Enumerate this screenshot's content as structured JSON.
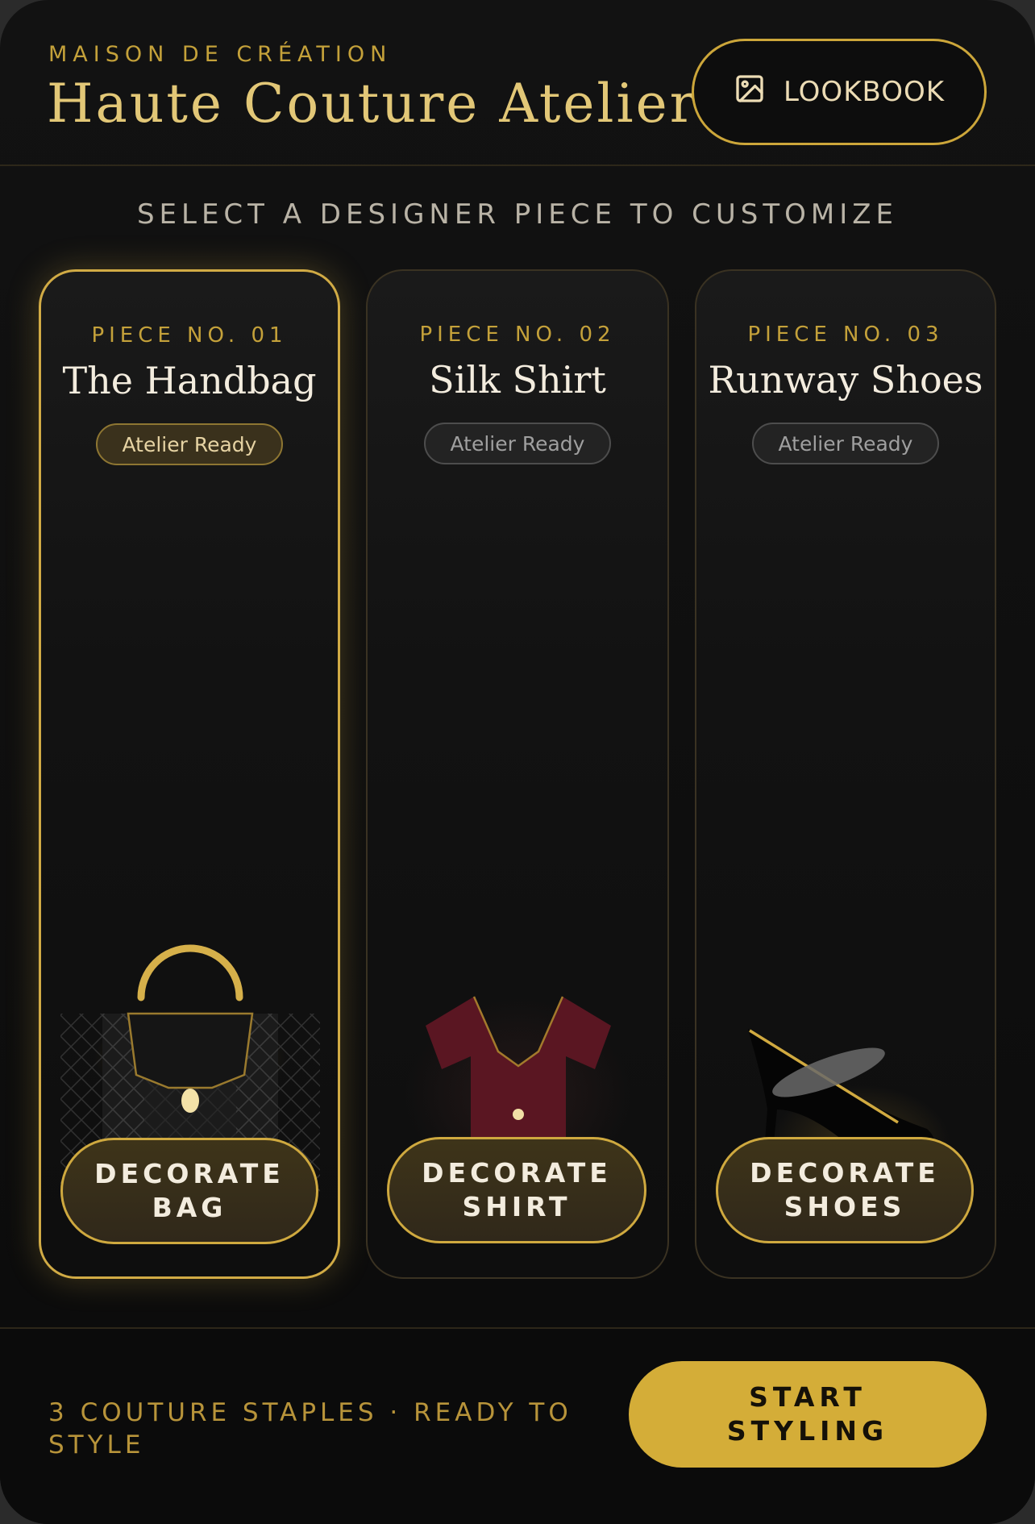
{
  "header": {
    "eyebrow": "MAISON DE CRÉATION",
    "title": "Haute Couture Atelier",
    "lookbook_label": "LOOKBOOK",
    "lookbook_icon": "image-icon"
  },
  "subtitle": "SELECT A DESIGNER PIECE TO CUSTOMIZE",
  "cards": [
    {
      "number": "PIECE NO. 01",
      "name": "The Handbag",
      "badge": "Atelier Ready",
      "cta_line1": "DECORATE",
      "cta_line2": "BAG",
      "icon": "handbag-illustration",
      "selected": true
    },
    {
      "number": "PIECE NO. 02",
      "name": "Silk Shirt",
      "badge": "Atelier Ready",
      "cta_line1": "DECORATE",
      "cta_line2": "SHIRT",
      "icon": "shirt-illustration",
      "selected": false
    },
    {
      "number": "PIECE NO. 03",
      "name": "Runway Shoes",
      "badge": "Atelier Ready",
      "cta_line1": "DECORATE",
      "cta_line2": "SHOES",
      "icon": "heel-shoe-illustration",
      "selected": false
    }
  ],
  "footer": {
    "summary": "3 COUTURE STAPLES · READY TO STYLE",
    "start_line1": "START",
    "start_line2": "STYLING"
  },
  "colors": {
    "gold": "#d4ad38",
    "gold_text": "#c4a13a",
    "background": "#0e0e0e",
    "shirt": "#5a1622"
  }
}
